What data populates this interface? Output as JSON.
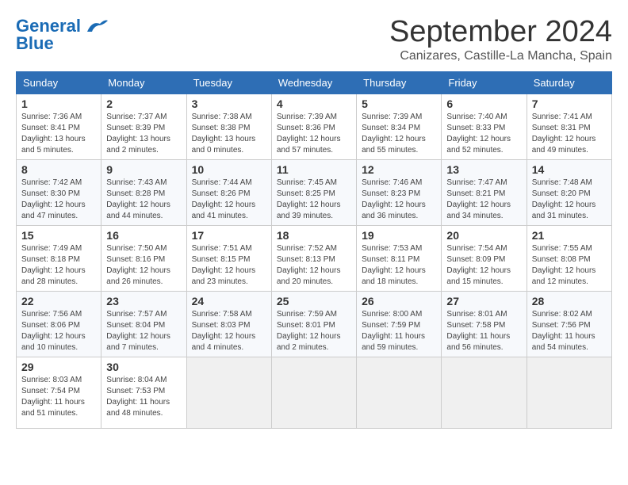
{
  "header": {
    "logo_line1": "General",
    "logo_line2": "Blue",
    "month_title": "September 2024",
    "subtitle": "Canizares, Castille-La Mancha, Spain"
  },
  "days_of_week": [
    "Sunday",
    "Monday",
    "Tuesday",
    "Wednesday",
    "Thursday",
    "Friday",
    "Saturday"
  ],
  "weeks": [
    [
      {
        "day": "1",
        "sunrise": "7:36 AM",
        "sunset": "8:41 PM",
        "daylight": "13 hours and 5 minutes."
      },
      {
        "day": "2",
        "sunrise": "7:37 AM",
        "sunset": "8:39 PM",
        "daylight": "13 hours and 2 minutes."
      },
      {
        "day": "3",
        "sunrise": "7:38 AM",
        "sunset": "8:38 PM",
        "daylight": "13 hours and 0 minutes."
      },
      {
        "day": "4",
        "sunrise": "7:39 AM",
        "sunset": "8:36 PM",
        "daylight": "12 hours and 57 minutes."
      },
      {
        "day": "5",
        "sunrise": "7:39 AM",
        "sunset": "8:34 PM",
        "daylight": "12 hours and 55 minutes."
      },
      {
        "day": "6",
        "sunrise": "7:40 AM",
        "sunset": "8:33 PM",
        "daylight": "12 hours and 52 minutes."
      },
      {
        "day": "7",
        "sunrise": "7:41 AM",
        "sunset": "8:31 PM",
        "daylight": "12 hours and 49 minutes."
      }
    ],
    [
      {
        "day": "8",
        "sunrise": "7:42 AM",
        "sunset": "8:30 PM",
        "daylight": "12 hours and 47 minutes."
      },
      {
        "day": "9",
        "sunrise": "7:43 AM",
        "sunset": "8:28 PM",
        "daylight": "12 hours and 44 minutes."
      },
      {
        "day": "10",
        "sunrise": "7:44 AM",
        "sunset": "8:26 PM",
        "daylight": "12 hours and 41 minutes."
      },
      {
        "day": "11",
        "sunrise": "7:45 AM",
        "sunset": "8:25 PM",
        "daylight": "12 hours and 39 minutes."
      },
      {
        "day": "12",
        "sunrise": "7:46 AM",
        "sunset": "8:23 PM",
        "daylight": "12 hours and 36 minutes."
      },
      {
        "day": "13",
        "sunrise": "7:47 AM",
        "sunset": "8:21 PM",
        "daylight": "12 hours and 34 minutes."
      },
      {
        "day": "14",
        "sunrise": "7:48 AM",
        "sunset": "8:20 PM",
        "daylight": "12 hours and 31 minutes."
      }
    ],
    [
      {
        "day": "15",
        "sunrise": "7:49 AM",
        "sunset": "8:18 PM",
        "daylight": "12 hours and 28 minutes."
      },
      {
        "day": "16",
        "sunrise": "7:50 AM",
        "sunset": "8:16 PM",
        "daylight": "12 hours and 26 minutes."
      },
      {
        "day": "17",
        "sunrise": "7:51 AM",
        "sunset": "8:15 PM",
        "daylight": "12 hours and 23 minutes."
      },
      {
        "day": "18",
        "sunrise": "7:52 AM",
        "sunset": "8:13 PM",
        "daylight": "12 hours and 20 minutes."
      },
      {
        "day": "19",
        "sunrise": "7:53 AM",
        "sunset": "8:11 PM",
        "daylight": "12 hours and 18 minutes."
      },
      {
        "day": "20",
        "sunrise": "7:54 AM",
        "sunset": "8:09 PM",
        "daylight": "12 hours and 15 minutes."
      },
      {
        "day": "21",
        "sunrise": "7:55 AM",
        "sunset": "8:08 PM",
        "daylight": "12 hours and 12 minutes."
      }
    ],
    [
      {
        "day": "22",
        "sunrise": "7:56 AM",
        "sunset": "8:06 PM",
        "daylight": "12 hours and 10 minutes."
      },
      {
        "day": "23",
        "sunrise": "7:57 AM",
        "sunset": "8:04 PM",
        "daylight": "12 hours and 7 minutes."
      },
      {
        "day": "24",
        "sunrise": "7:58 AM",
        "sunset": "8:03 PM",
        "daylight": "12 hours and 4 minutes."
      },
      {
        "day": "25",
        "sunrise": "7:59 AM",
        "sunset": "8:01 PM",
        "daylight": "12 hours and 2 minutes."
      },
      {
        "day": "26",
        "sunrise": "8:00 AM",
        "sunset": "7:59 PM",
        "daylight": "11 hours and 59 minutes."
      },
      {
        "day": "27",
        "sunrise": "8:01 AM",
        "sunset": "7:58 PM",
        "daylight": "11 hours and 56 minutes."
      },
      {
        "day": "28",
        "sunrise": "8:02 AM",
        "sunset": "7:56 PM",
        "daylight": "11 hours and 54 minutes."
      }
    ],
    [
      {
        "day": "29",
        "sunrise": "8:03 AM",
        "sunset": "7:54 PM",
        "daylight": "11 hours and 51 minutes."
      },
      {
        "day": "30",
        "sunrise": "8:04 AM",
        "sunset": "7:53 PM",
        "daylight": "11 hours and 48 minutes."
      },
      null,
      null,
      null,
      null,
      null
    ]
  ],
  "labels": {
    "sunrise_prefix": "Sunrise: ",
    "sunset_prefix": "Sunset: ",
    "daylight_prefix": "Daylight: "
  }
}
